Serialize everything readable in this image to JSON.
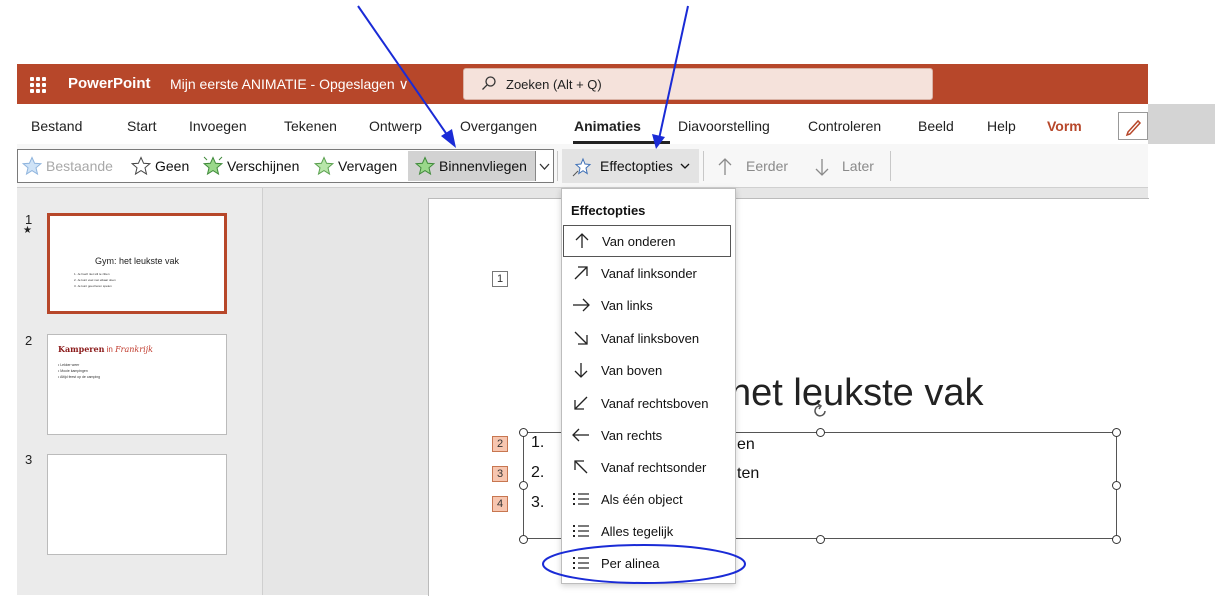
{
  "titlebar": {
    "app_name": "PowerPoint",
    "doc_title": "Mijn eerste ANIMATIE - Opgeslagen ∨",
    "search_label": "Zoeken (Alt + Q)"
  },
  "ribbon": {
    "tabs": [
      "Bestand",
      "Start",
      "Invoegen",
      "Tekenen",
      "Ontwerp",
      "Overgangen",
      "Animaties",
      "Diavoorstelling",
      "Controleren",
      "Beeld",
      "Help",
      "Vorm"
    ],
    "active_tab": "Animaties"
  },
  "toolbar": {
    "gallery": [
      "Bestaande",
      "Geen",
      "Verschijnen",
      "Vervagen",
      "Binnenvliegen"
    ],
    "effect_options_label": "Effectopties",
    "earlier_label": "Eerder",
    "later_label": "Later"
  },
  "thumbnails": {
    "numbers": [
      "1",
      "2",
      "3"
    ],
    "star": "★",
    "slide1_title": "Gym: het leukste vak",
    "slide1_lines": [
      "1. Je hoeft niet stil te zitten",
      "2. Je kunt veel met elkaar doen",
      "3. Je kunt goed leren spelen"
    ],
    "slide2_title_a": "Kamperen",
    "slide2_title_b": "in",
    "slide2_title_c": "Frankrijk",
    "slide2_lines": [
      "• Lekker weer",
      "• Mooie kampingen",
      "• Altijd feest op de camping"
    ]
  },
  "slide": {
    "tags": [
      "1",
      "2",
      "3",
      "4"
    ],
    "title_fragment": "het leukste vak",
    "bullet_numbers": [
      "1.",
      "2.",
      "3."
    ],
    "bullet_tail_1": "en",
    "bullet_tail_2": "ten"
  },
  "menu": {
    "header": "Effectopties",
    "items": [
      "Van onderen",
      "Vanaf linksonder",
      "Van links",
      "Vanaf linksboven",
      "Van boven",
      "Vanaf rechtsboven",
      "Van rechts",
      "Vanaf rechtsonder",
      "Als één object",
      "Alles tegelijk",
      "Per alinea"
    ],
    "icons": [
      "arrow-up-icon",
      "arrow-up-right-icon",
      "arrow-right-icon",
      "arrow-down-right-icon",
      "arrow-down-icon",
      "arrow-down-left-icon",
      "arrow-left-icon",
      "arrow-up-left-icon",
      "list-icon",
      "list-icon",
      "list-icon"
    ],
    "selected": "Van onderen",
    "highlighted": "Per alinea"
  },
  "colors": {
    "brand": "#b7472a",
    "annotation": "#1a2bd6",
    "tag_fill": "#f7c6b0"
  }
}
